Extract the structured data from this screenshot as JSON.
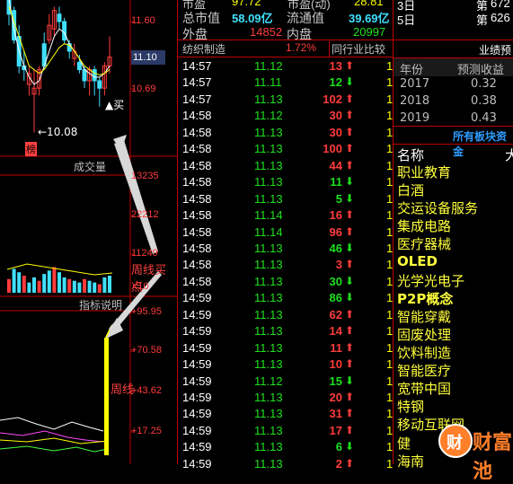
{
  "left_chart": {
    "price_axis": [
      "11.60",
      "11.10",
      "10.69"
    ],
    "low_label": "←10.08",
    "buy_label": "▲买",
    "rank_tag": "榜",
    "volume_tab": "成交量",
    "volume_axis": [
      "13235",
      "22212",
      "11249"
    ],
    "x10": "X10",
    "indicator_tab": "指标说明",
    "indicator_axis": [
      "+95.95",
      "+70.58",
      "+43.62",
      "+17.25"
    ],
    "annotation_weekly_buy": "周线买点",
    "annotation_weekly": "周线",
    "watermark": "财富池",
    "watermark_icon": "cfp-logo-icon"
  },
  "summary": {
    "row0": {
      "k1": "市盈",
      "v1": "97.72",
      "k2": "市盈(动)",
      "v2": "28.81"
    },
    "row1": {
      "k1": "总市值",
      "v1": "58.09亿",
      "k2": "流通值",
      "v2": "39.69亿"
    },
    "row2": {
      "k1": "外盘",
      "v1": "14852",
      "k2": "内盘",
      "v2": "20997"
    },
    "row3": {
      "industry": "纺织制造",
      "pct": "1.72%",
      "compare": "同行业比较"
    }
  },
  "ticks": [
    {
      "time": "14:57",
      "price": "11.12",
      "vol": "13",
      "dir": "up"
    },
    {
      "time": "14:57",
      "price": "11.11",
      "vol": "12",
      "dir": "down"
    },
    {
      "time": "14:57",
      "price": "11.13",
      "vol": "102",
      "dir": "up"
    },
    {
      "time": "14:58",
      "price": "11.12",
      "vol": "30",
      "dir": "up"
    },
    {
      "time": "14:58",
      "price": "11.13",
      "vol": "30",
      "dir": "up"
    },
    {
      "time": "14:58",
      "price": "11.13",
      "vol": "100",
      "dir": "up"
    },
    {
      "time": "14:58",
      "price": "11.13",
      "vol": "44",
      "dir": "up"
    },
    {
      "time": "14:58",
      "price": "11.13",
      "vol": "11",
      "dir": "down"
    },
    {
      "time": "14:58",
      "price": "11.13",
      "vol": "5",
      "dir": "down"
    },
    {
      "time": "14:58",
      "price": "11.14",
      "vol": "16",
      "dir": "up"
    },
    {
      "time": "14:58",
      "price": "11.14",
      "vol": "96",
      "dir": "up"
    },
    {
      "time": "14:58",
      "price": "11.13",
      "vol": "46",
      "dir": "down"
    },
    {
      "time": "14:58",
      "price": "11.13",
      "vol": "3",
      "dir": "up"
    },
    {
      "time": "14:58",
      "price": "11.13",
      "vol": "30",
      "dir": "down"
    },
    {
      "time": "14:59",
      "price": "11.13",
      "vol": "86",
      "dir": "down"
    },
    {
      "time": "14:59",
      "price": "11.13",
      "vol": "62",
      "dir": "up"
    },
    {
      "time": "14:59",
      "price": "11.13",
      "vol": "14",
      "dir": "up"
    },
    {
      "time": "14:59",
      "price": "11.13",
      "vol": "11",
      "dir": "up"
    },
    {
      "time": "14:59",
      "price": "11.13",
      "vol": "10",
      "dir": "up"
    },
    {
      "time": "14:59",
      "price": "11.12",
      "vol": "15",
      "dir": "down"
    },
    {
      "time": "14:59",
      "price": "11.13",
      "vol": "20",
      "dir": "up"
    },
    {
      "time": "14:59",
      "price": "11.13",
      "vol": "31",
      "dir": "up"
    },
    {
      "time": "14:59",
      "price": "11.13",
      "vol": "17",
      "dir": "up"
    },
    {
      "time": "14:59",
      "price": "11.13",
      "vol": "6",
      "dir": "down"
    },
    {
      "time": "14:59",
      "price": "11.13",
      "vol": "2",
      "dir": "up"
    }
  ],
  "right_panel": {
    "top_rows": [
      {
        "label": "3日",
        "rank_label": "第",
        "rank": "672"
      },
      {
        "label": "5日",
        "rank_label": "第",
        "rank": "626"
      }
    ],
    "forecast_title": "业绩预测",
    "forecast_header": {
      "year": "年份",
      "eps": "预测收益"
    },
    "forecast_rows": [
      {
        "year": "2017",
        "eps": "0.32"
      },
      {
        "year": "2018",
        "eps": "0.38"
      },
      {
        "year": "2019",
        "eps": "0.43"
      }
    ],
    "sectors_title": "所有板块资金",
    "sectors_header": {
      "name": "名称",
      "extra": "大"
    },
    "sectors": [
      "职业教育",
      "白酒",
      "交运设备服务",
      "集成电路",
      "医疗器械",
      "OLED",
      "光学光电子",
      "P2P概念",
      "智能穿戴",
      "固废处理",
      "饮料制造",
      "智能医疗",
      "宽带中国",
      "特钢",
      "移动互联网",
      "健",
      "海南"
    ]
  }
}
